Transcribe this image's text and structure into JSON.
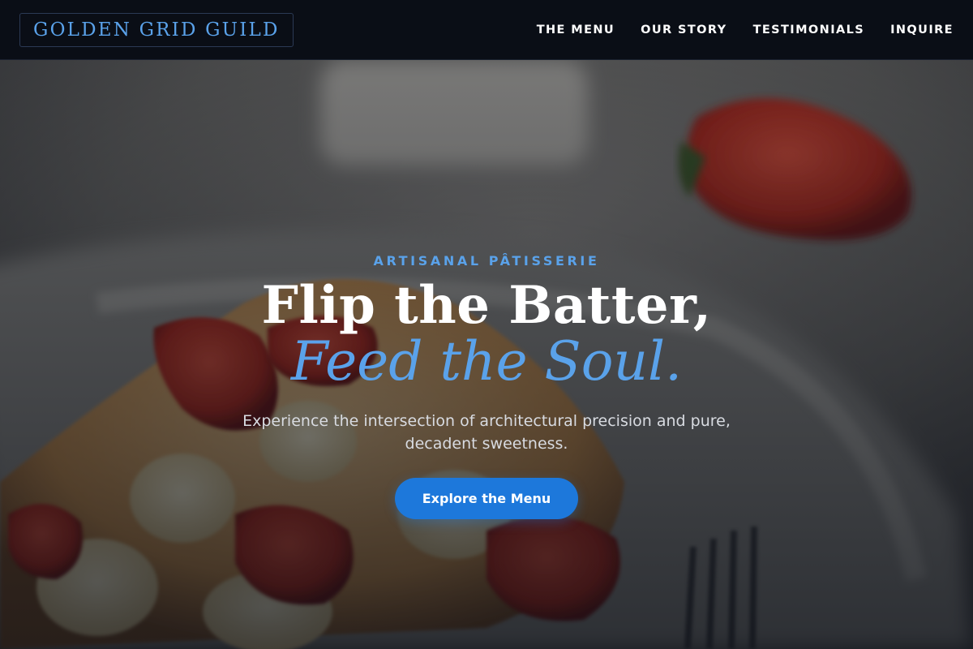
{
  "nav": {
    "logo": "GOLDEN GRID GUILD",
    "items": [
      {
        "label": "THE MENU"
      },
      {
        "label": "OUR STORY"
      },
      {
        "label": "TESTIMONIALS"
      },
      {
        "label": "INQUIRE"
      }
    ]
  },
  "hero": {
    "eyebrow": "ARTISANAL PÂTISSERIE",
    "headline_line1": "Flip the Batter,",
    "headline_line2": "Feed the Soul.",
    "subtitle": "Experience the intersection of architectural precision and pure, decadent sweetness.",
    "cta_label": "Explore the Menu",
    "background_image": "strawberry-pastry-photo"
  },
  "colors": {
    "nav_bg": "#0a0e16",
    "accent_blue": "#5aa2ea",
    "button_blue": "#1d78db",
    "text_white": "#ffffff"
  }
}
